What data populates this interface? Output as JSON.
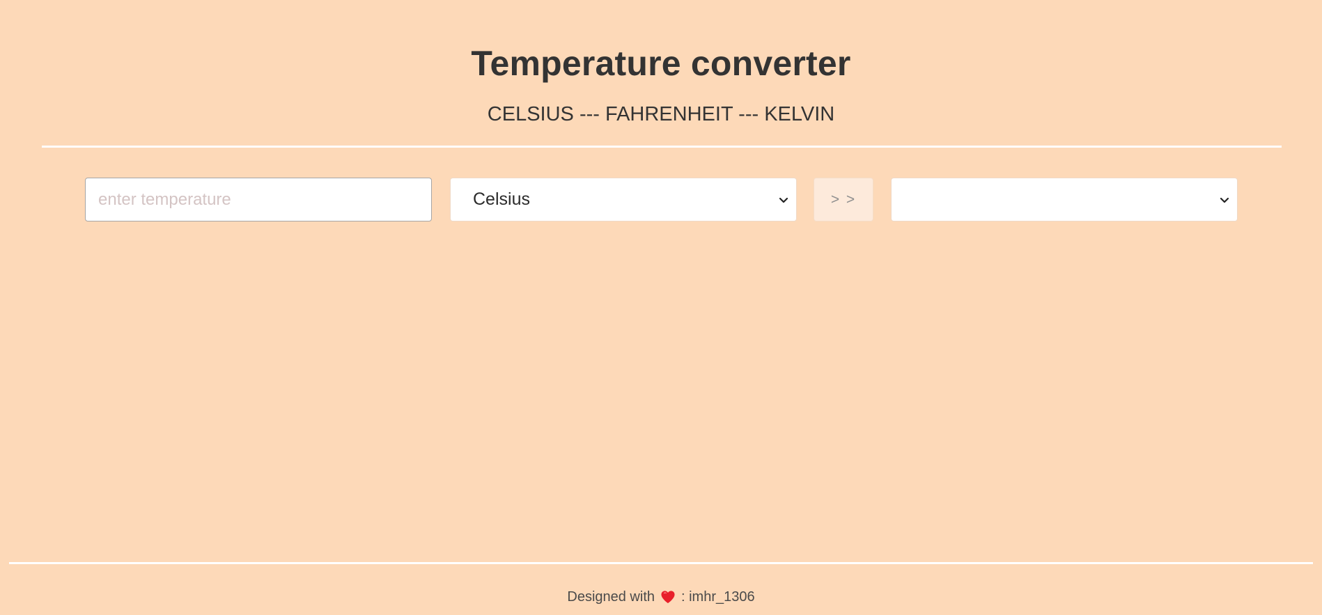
{
  "header": {
    "title": "Temperature converter",
    "subtitle": "CELSIUS --- FAHRENHEIT --- KELVIN"
  },
  "converter": {
    "input_placeholder": "enter temperature",
    "input_value": "",
    "from_unit": "Celsius",
    "to_unit": "",
    "convert_label": "> >"
  },
  "footer": {
    "prefix": "Designed with",
    "icon": "heart-icon",
    "suffix": ": imhr_1306"
  },
  "colors": {
    "background": "#fdd9b8",
    "divider": "#ffffff",
    "heart": "#e8202a"
  }
}
